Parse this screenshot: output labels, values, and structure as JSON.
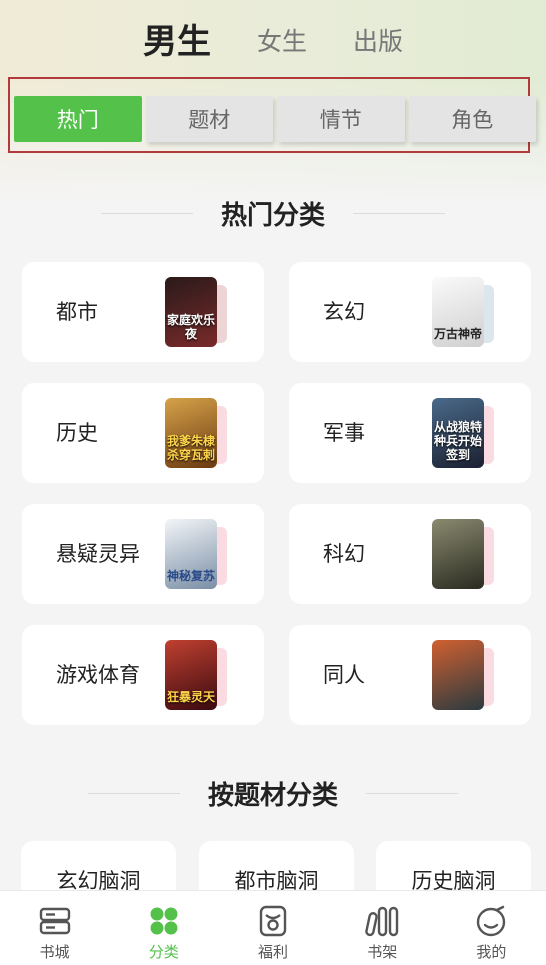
{
  "gender_tabs": [
    {
      "label": "男生",
      "active": true
    },
    {
      "label": "女生",
      "active": false
    },
    {
      "label": "出版",
      "active": false
    }
  ],
  "category_tabs": [
    {
      "label": "热门",
      "active": true
    },
    {
      "label": "题材",
      "active": false
    },
    {
      "label": "情节",
      "active": false
    },
    {
      "label": "角色",
      "active": false
    }
  ],
  "hot_section": {
    "title": "热门分类",
    "genres": [
      {
        "label": "都市",
        "cover_text": "家庭欢乐夜",
        "cover_color": "#7a2a2a"
      },
      {
        "label": "玄幻",
        "cover_text": "万古神帝",
        "cover_color": "#e9e9e9"
      },
      {
        "label": "历史",
        "cover_text": "我爹朱棣杀穿瓦剌",
        "cover_color": "#8a5a1e"
      },
      {
        "label": "军事",
        "cover_text": "从战狼特种兵开始签到",
        "cover_color": "#2a3850"
      },
      {
        "label": "悬疑灵异",
        "cover_text": "神秘复苏",
        "cover_color": "#a9b9c9"
      },
      {
        "label": "科幻",
        "cover_text": "",
        "cover_color": "#4a4a3a"
      },
      {
        "label": "游戏体育",
        "cover_text": "狂暴灵天",
        "cover_color": "#6a1a1a"
      },
      {
        "label": "同人",
        "cover_text": "",
        "cover_color": "#3a3f45"
      }
    ]
  },
  "theme_section": {
    "title": "按题材分类",
    "items": [
      "玄幻脑洞",
      "都市脑洞",
      "历史脑洞"
    ]
  },
  "bottom_nav": [
    {
      "label": "书城",
      "icon": "bookstore-icon",
      "active": false
    },
    {
      "label": "分类",
      "icon": "category-icon",
      "active": true
    },
    {
      "label": "福利",
      "icon": "gift-icon",
      "active": false
    },
    {
      "label": "书架",
      "icon": "bookshelf-icon",
      "active": false
    },
    {
      "label": "我的",
      "icon": "profile-icon",
      "active": false
    }
  ],
  "colors": {
    "accent": "#54c14b",
    "highlight_frame": "#b33a3a"
  }
}
